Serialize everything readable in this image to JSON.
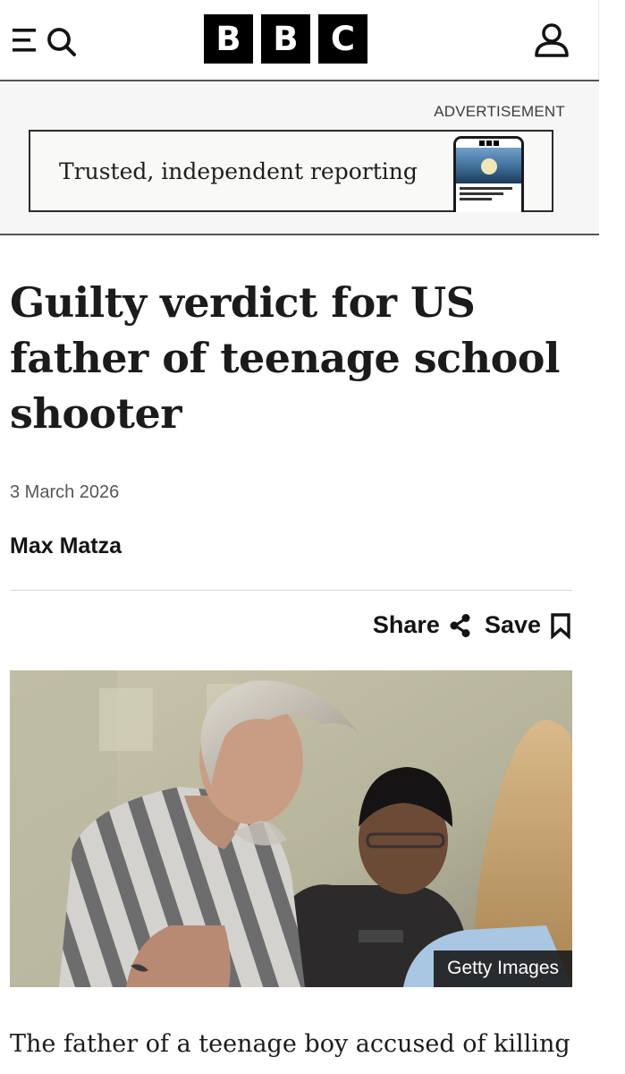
{
  "header": {
    "brand_letters": [
      "B",
      "B",
      "C"
    ],
    "menu_icons": [
      "menu-icon",
      "search-icon"
    ],
    "account_icon": "user-icon"
  },
  "advert": {
    "label": "ADVERTISEMENT",
    "banner_text": "Trusted, independent reporting"
  },
  "article": {
    "headline": "Guilty verdict for US father of teenage school shooter",
    "date": "3 March 2026",
    "author": "Max Matza",
    "share_label": "Share",
    "save_label": "Save",
    "image_credit": "Getty Images",
    "first_paragraph": "The father of a teenage boy accused of killing"
  },
  "colors": {
    "brand_black": "#000000",
    "text": "#141414",
    "muted": "#545658",
    "ad_background": "#f6f6f6"
  }
}
